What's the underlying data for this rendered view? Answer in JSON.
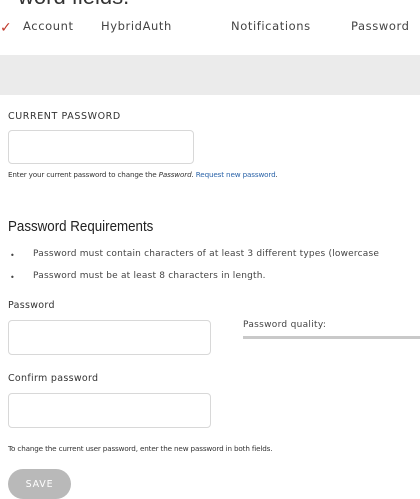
{
  "page": {
    "title_fragment": "word fields."
  },
  "tabs": [
    {
      "label": "Account"
    },
    {
      "label": "HybridAuth"
    },
    {
      "label": "Notifications"
    },
    {
      "label": "Password"
    }
  ],
  "current_password": {
    "label": "CURRENT PASSWORD",
    "value": "",
    "help_prefix": "Enter your current password to change the ",
    "help_em": "Password",
    "help_mid": ". ",
    "help_link": "Request new password",
    "help_suffix": "."
  },
  "requirements": {
    "heading": "Password Requirements",
    "items": [
      "Password must contain characters of at least 3 different types (lowercase",
      "Password must be at least 8 characters in length."
    ]
  },
  "password_field": {
    "label": "Password",
    "value": ""
  },
  "quality": {
    "label": "Password quality:"
  },
  "confirm_field": {
    "label": "Confirm password",
    "value": ""
  },
  "form_help": "To change the current user password, enter the new password in both fields.",
  "save_button": {
    "label": "SAVE"
  },
  "colors": {
    "link": "#2a63a8",
    "gray_bar": "#ebebeb",
    "save_button_bg": "#b9b9b9",
    "red_mark": "#c0392b"
  }
}
